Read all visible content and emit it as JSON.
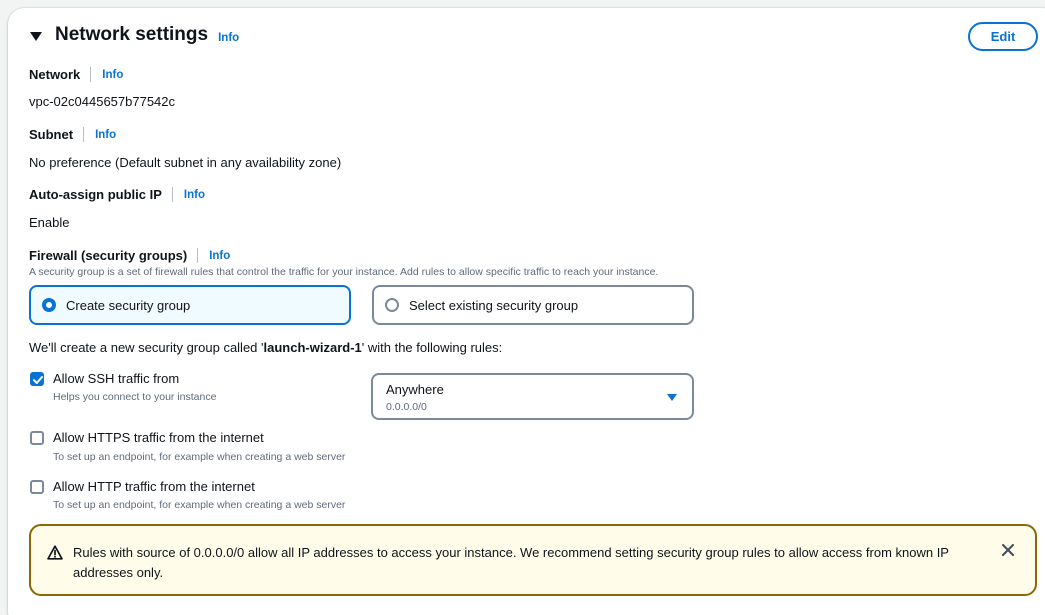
{
  "section": {
    "title": "Network settings",
    "info_label": "Info",
    "edit_label": "Edit"
  },
  "network": {
    "label": "Network",
    "info": "Info",
    "value": "vpc-02c0445657b77542c"
  },
  "subnet": {
    "label": "Subnet",
    "info": "Info",
    "value": "No preference (Default subnet in any availability zone)"
  },
  "auto_assign": {
    "label": "Auto-assign public IP",
    "info": "Info",
    "value": "Enable"
  },
  "firewall": {
    "label": "Firewall (security groups)",
    "info": "Info",
    "description": "A security group is a set of firewall rules that control the traffic for your instance. Add rules to allow specific traffic to reach your instance.",
    "options": [
      {
        "label": "Create security group",
        "selected": true
      },
      {
        "label": "Select existing security group",
        "selected": false
      }
    ],
    "sentence_prefix": "We'll create a new security group called '",
    "group_name": "launch-wizard-1",
    "sentence_suffix": "' with the following rules:"
  },
  "rules": [
    {
      "label": "Allow SSH traffic from",
      "description": "Helps you connect to your instance",
      "checked": true
    },
    {
      "label": "Allow HTTPS traffic from the internet",
      "description": "To set up an endpoint, for example when creating a web server",
      "checked": false
    },
    {
      "label": "Allow HTTP traffic from the internet",
      "description": "To set up an endpoint, for example when creating a web server",
      "checked": false
    }
  ],
  "ssh_source": {
    "value": "Anywhere",
    "sub": "0.0.0.0/0",
    "icon": "caret-down-icon"
  },
  "alert": {
    "text": "Rules with source of 0.0.0.0/0 allow all IP addresses to access your instance. We recommend setting security group rules to allow access from known IP addresses only.",
    "icon": "warning-icon",
    "dismiss_icon": "close-icon"
  },
  "colors": {
    "accent": "#0972d3",
    "warning_border": "#8d6605",
    "warning_bg": "#fffce9",
    "text": "#0f141a",
    "muted": "#5f6b7a"
  }
}
